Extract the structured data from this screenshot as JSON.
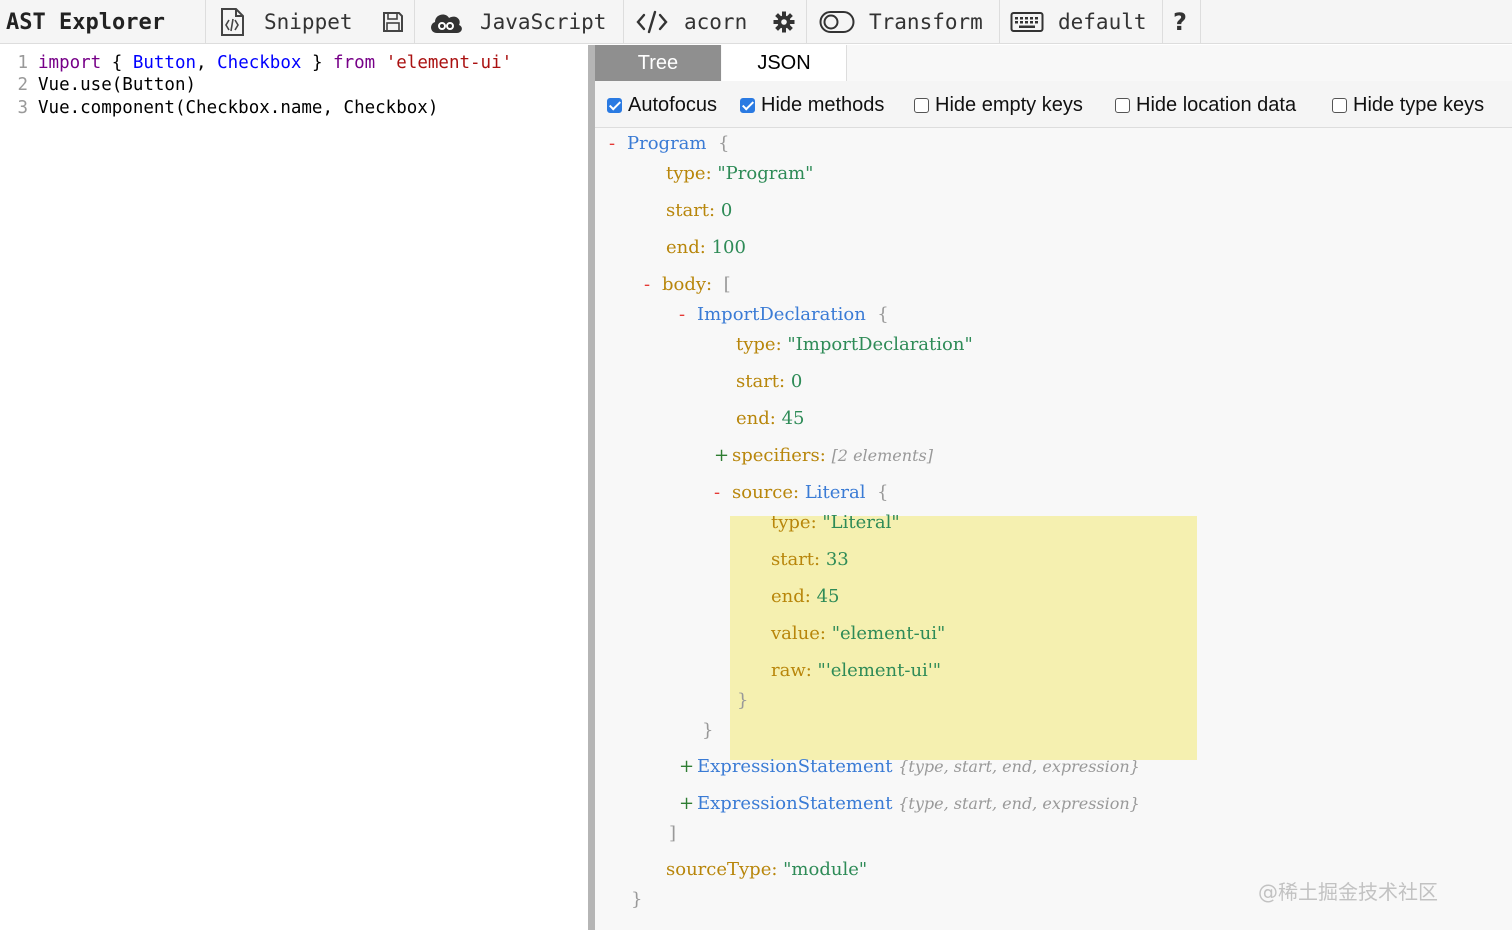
{
  "toolbar": {
    "app_title": "AST Explorer",
    "snippet_label": "Snippet",
    "language_label": "JavaScript",
    "parser_label": "acorn",
    "transform_label": "Transform",
    "keymap_label": "default",
    "help_label": "?"
  },
  "editor": {
    "lines": [
      {
        "num": "1",
        "t": [
          {
            "c": "kw",
            "v": "import"
          },
          {
            "c": "",
            "v": " { "
          },
          {
            "c": "def",
            "v": "Button"
          },
          {
            "c": "",
            "v": ", "
          },
          {
            "c": "def",
            "v": "Checkbox"
          },
          {
            "c": "",
            "v": " } "
          },
          {
            "c": "kw",
            "v": "from"
          },
          {
            "c": "",
            "v": " "
          },
          {
            "c": "str",
            "v": "'element-ui'"
          }
        ]
      },
      {
        "num": "2",
        "t": [
          {
            "c": "",
            "v": "Vue.use(Button)"
          }
        ]
      },
      {
        "num": "3",
        "t": [
          {
            "c": "",
            "v": "Vue.component(Checkbox.name, Checkbox)"
          }
        ]
      }
    ]
  },
  "output": {
    "tabs": [
      "Tree",
      "JSON"
    ],
    "options": [
      {
        "label": "Autofocus",
        "checked": true
      },
      {
        "label": "Hide methods",
        "checked": true
      },
      {
        "label": "Hide empty keys",
        "checked": false
      },
      {
        "label": "Hide location data",
        "checked": false
      },
      {
        "label": "Hide type keys",
        "checked": false
      }
    ],
    "tree": {
      "program_label": "Program",
      "open_brace": "{",
      "close_brace": "}",
      "open_bracket": "[",
      "close_bracket": "]",
      "program": {
        "type_key": "type:",
        "type_val": "\"Program\"",
        "start_key": "start:",
        "start_val": "0",
        "end_key": "end:",
        "end_val": "100",
        "body_key": "body:",
        "sourcetype_key": "sourceType:",
        "sourcetype_val": "\"module\""
      },
      "import": {
        "label": "ImportDeclaration",
        "type_key": "type:",
        "type_val": "\"ImportDeclaration\"",
        "start_key": "start:",
        "start_val": "0",
        "end_key": "end:",
        "end_val": "45",
        "spec_key": "specifiers:",
        "spec_summary": "[2 elements]"
      },
      "source": {
        "key": "source:",
        "label": "Literal",
        "type_key": "type:",
        "type_val": "\"Literal\"",
        "start_key": "start:",
        "start_val": "33",
        "end_key": "end:",
        "end_val": "45",
        "value_key": "value:",
        "value_val": "\"element-ui\"",
        "raw_key": "raw:",
        "raw_val": "\"'element-ui'\""
      },
      "expr": [
        {
          "label": "ExpressionStatement",
          "summary": "{type, start, end, expression}"
        },
        {
          "label": "ExpressionStatement",
          "summary": "{type, start, end, expression}"
        }
      ],
      "toggle_open": "-",
      "toggle_closed": "+"
    }
  },
  "watermark": "@稀土掘金技术社区"
}
